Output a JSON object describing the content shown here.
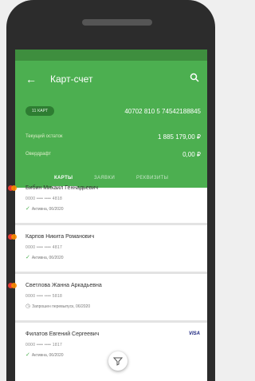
{
  "header": {
    "title": "Карт-счет",
    "account_badge": "11 КАРТ",
    "account_number": "40702 810 5 74542188845",
    "balance_label": "Текущий остаток",
    "balance_value": "1 885 179,00 ₽",
    "overdraft_label": "Овердрафт",
    "overdraft_value": "0,00 ₽",
    "tabs": [
      {
        "label": "КАРТЫ",
        "active": true
      },
      {
        "label": "ЗАЯВКИ",
        "active": false
      },
      {
        "label": "РЕКВИЗИТЫ",
        "active": false
      }
    ],
    "back_icon": "back-arrow-icon",
    "search_icon": "search-icon"
  },
  "cards": [
    {
      "name": "Бибин Михаил Геннадьевич",
      "pan": "0000 •••• •••• 4818",
      "status": "Активна, 06/2020",
      "status_icon": "check-icon",
      "brand": "mastercard"
    },
    {
      "name": "Карпов Никита Романович",
      "pan": "0000 •••• •••• 4817",
      "status": "Активна, 06/2020",
      "status_icon": "check-icon",
      "brand": "mastercard"
    },
    {
      "name": "Светлова Жанна Аркадьевна",
      "pan": "0000 •••• •••• 5818",
      "status": "Запрошен перевыпуск, 06/2020",
      "status_icon": "clock-icon",
      "brand": "mastercard"
    },
    {
      "name": "Филатов Евгений Сергеевич",
      "pan": "0000 •••• •••• 1817",
      "status": "Активна, 06/2020",
      "status_icon": "check-icon",
      "brand": "visa",
      "brand_label": "VISA"
    }
  ],
  "colors": {
    "header_green": "#4caf50",
    "status_bar_green": "#3e8e3e",
    "badge_green": "#2e7d32"
  },
  "filter_icon": "filter-icon"
}
